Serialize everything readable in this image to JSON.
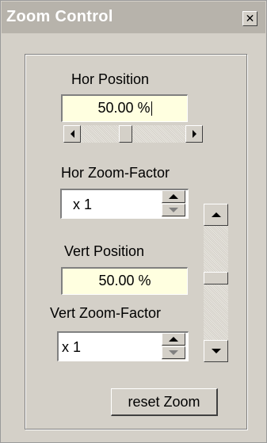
{
  "window": {
    "title": "Zoom Control",
    "close_icon": "close-icon"
  },
  "hor_position": {
    "label": "Hor Position",
    "value": "50.00 %",
    "scroll_fraction": 0.5
  },
  "hor_zoom": {
    "label": "Hor Zoom-Factor",
    "value": "x 1"
  },
  "vert_position": {
    "label": "Vert Position",
    "value": "50.00 %",
    "scroll_fraction": 0.5
  },
  "vert_zoom": {
    "label": "Vert Zoom-Factor",
    "value": "x 1"
  },
  "reset_button": {
    "label": "reset Zoom"
  },
  "colors": {
    "face": "#d4d0c8",
    "title_bar": "#b7b3ab",
    "field_bg": "#ffffe0"
  }
}
